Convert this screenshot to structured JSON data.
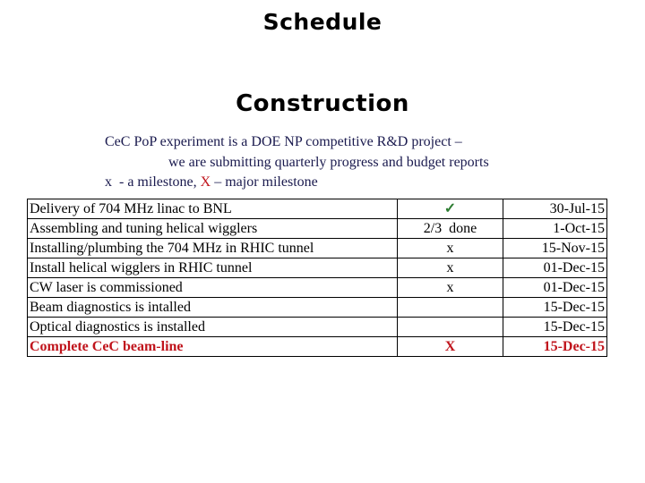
{
  "title": "Schedule",
  "subtitle": "Construction",
  "intro": {
    "line1": "CeC PoP experiment is a DOE NP competitive R&D project –",
    "line2": "we are submitting quarterly progress and budget reports",
    "legend_minor": "x  - a milestone, ",
    "legend_major_symbol": "X",
    "legend_major_text": " – major milestone"
  },
  "colors": {
    "major": "#c0141c",
    "done_check": "#2e7d32",
    "intro_text": "#1a1a4e"
  },
  "milestones": [
    {
      "task": "Delivery of 704 MHz linac to BNL",
      "status": "✓",
      "date": "30-Jul-15"
    },
    {
      "task": "Assembling and tuning helical wigglers",
      "status": "2/3  done",
      "date": "1-Oct-15"
    },
    {
      "task": "Installing/plumbing the 704 MHz in RHIC tunnel",
      "status": "x",
      "date": "15-Nov-15"
    },
    {
      "task": "Install helical wigglers in RHIC tunnel",
      "status": "x",
      "date": "01-Dec-15"
    },
    {
      "task": "CW laser is commissioned",
      "status": "x",
      "date": "01-Dec-15"
    },
    {
      "task": "Beam diagnostics is intalled",
      "status": "",
      "date": "15-Dec-15"
    },
    {
      "task": "Optical diagnostics is installed",
      "status": "",
      "date": "15-Dec-15"
    },
    {
      "task": "Complete CeC beam-line",
      "status": "X",
      "date": "15-Dec-15"
    }
  ]
}
